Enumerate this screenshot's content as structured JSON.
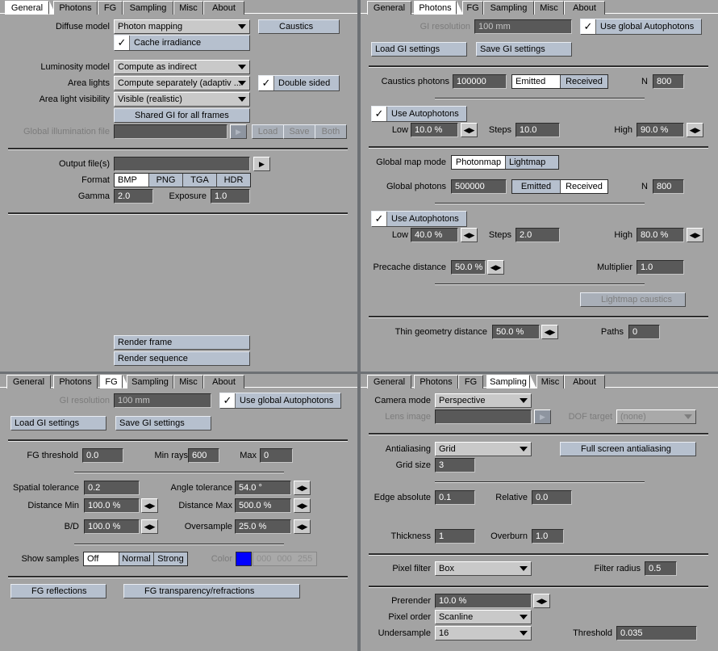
{
  "tabs": [
    "General",
    "Photons",
    "FG",
    "Sampling",
    "Misc",
    "About"
  ],
  "general": {
    "diffuse_model_label": "Diffuse model",
    "diffuse_model_value": "Photon mapping",
    "caustics_label": "Caustics",
    "cache_irradiance_label": "Cache irradiance",
    "luminosity_model_label": "Luminosity model",
    "luminosity_model_value": "Compute as indirect",
    "area_lights_label": "Area lights",
    "area_lights_value": "Compute separately (adaptiv ...",
    "double_sided_label": "Double sided",
    "area_light_visibility_label": "Area light visibility",
    "area_light_visibility_value": "Visible (realistic)",
    "shared_gi_label": "Shared GI for all frames",
    "gi_file_label": "Global illumination file",
    "gi_file_value": "",
    "load_label": "Load",
    "save_label": "Save",
    "both_label": "Both",
    "output_files_label": "Output file(s)",
    "output_files_value": "",
    "format_label": "Format",
    "formats": [
      "BMP",
      "PNG",
      "TGA",
      "HDR"
    ],
    "gamma_label": "Gamma",
    "gamma_value": "2.0",
    "exposure_label": "Exposure",
    "exposure_value": "1.0",
    "render_frame_label": "Render frame",
    "render_sequence_label": "Render sequence"
  },
  "photons": {
    "gi_resolution_label": "GI resolution",
    "gi_resolution_value": "100 mm",
    "use_global_autophotons_label": "Use global Autophotons",
    "load_gi_label": "Load GI settings",
    "save_gi_label": "Save GI settings",
    "caustics_photons_label": "Caustics photons",
    "caustics_photons_value": "100000",
    "emitted_label": "Emitted",
    "received_label": "Received",
    "n_label": "N",
    "caustics_n_value": "800",
    "use_autophotons_label": "Use Autophotons",
    "low_label": "Low",
    "steps_label": "Steps",
    "high_label": "High",
    "c_low_value": "10.0 %",
    "c_steps_value": "10.0",
    "c_high_value": "90.0 %",
    "global_map_mode_label": "Global map mode",
    "photonmap_label": "Photonmap",
    "lightmap_label": "Lightmap",
    "global_photons_label": "Global photons",
    "global_photons_value": "500000",
    "global_n_value": "800",
    "g_low_value": "40.0 %",
    "g_steps_value": "2.0",
    "g_high_value": "80.0 %",
    "precache_distance_label": "Precache distance",
    "precache_distance_value": "50.0 %",
    "multiplier_label": "Multiplier",
    "multiplier_value": "1.0",
    "lightmap_caustics_label": "Lightmap caustics",
    "thin_geometry_label": "Thin geometry distance",
    "thin_geometry_value": "50.0 %",
    "paths_label": "Paths",
    "paths_value": "0"
  },
  "fg": {
    "gi_resolution_label": "GI resolution",
    "gi_resolution_value": "100 mm",
    "use_global_autophotons_label": "Use global Autophotons",
    "load_gi_label": "Load GI settings",
    "save_gi_label": "Save GI settings",
    "fg_threshold_label": "FG threshold",
    "fg_threshold_value": "0.0",
    "min_rays_label": "Min rays",
    "min_rays_value": "600",
    "max_label": "Max",
    "max_value": "0",
    "spatial_tolerance_label": "Spatial tolerance",
    "spatial_tolerance_value": "0.2",
    "angle_tolerance_label": "Angle tolerance",
    "angle_tolerance_value": "54.0 °",
    "distance_min_label": "Distance Min",
    "distance_min_value": "100.0 %",
    "distance_max_label": "Distance Max",
    "distance_max_value": "500.0 %",
    "bd_label": "B/D",
    "bd_value": "100.0 %",
    "oversample_label": "Oversample",
    "oversample_value": "25.0 %",
    "show_samples_label": "Show samples",
    "show_samples_options": [
      "Off",
      "Normal",
      "Strong"
    ],
    "color_label": "Color",
    "color_r": "000",
    "color_g": "000",
    "color_b": "255",
    "color_swatch": "#0000ff",
    "fg_reflections_label": "FG reflections",
    "fg_transparency_label": "FG transparency/refractions"
  },
  "sampling": {
    "camera_mode_label": "Camera mode",
    "camera_mode_value": "Perspective",
    "lens_image_label": "Lens image",
    "lens_image_value": "",
    "dof_target_label": "DOF target",
    "dof_target_value": "(none)",
    "antialiasing_label": "Antialiasing",
    "antialiasing_value": "Grid",
    "full_screen_aa_label": "Full screen antialiasing",
    "grid_size_label": "Grid size",
    "grid_size_value": "3",
    "edge_absolute_label": "Edge absolute",
    "edge_absolute_value": "0.1",
    "relative_label": "Relative",
    "relative_value": "0.0",
    "thickness_label": "Thickness",
    "thickness_value": "1",
    "overburn_label": "Overburn",
    "overburn_value": "1.0",
    "pixel_filter_label": "Pixel filter",
    "pixel_filter_value": "Box",
    "filter_radius_label": "Filter radius",
    "filter_radius_value": "0.5",
    "prerender_label": "Prerender",
    "prerender_value": "10.0 %",
    "pixel_order_label": "Pixel order",
    "pixel_order_value": "Scanline",
    "undersample_label": "Undersample",
    "undersample_value": "16",
    "threshold_label": "Threshold",
    "threshold_value": "0.035"
  }
}
